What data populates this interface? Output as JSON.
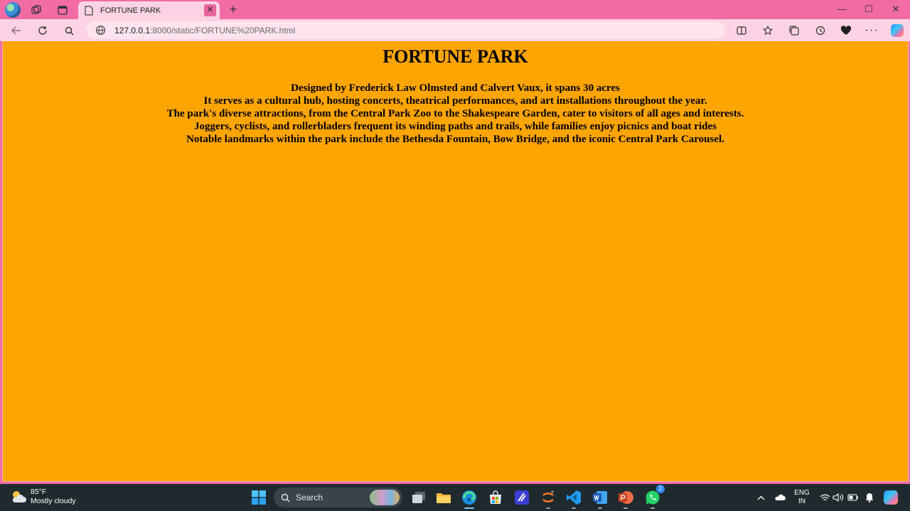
{
  "browser": {
    "tab_title": "FORTUNE PARK",
    "address_host": "127.0.0.1",
    "address_rest": ":8000/static/FORTUNE%20PARK.html",
    "window_controls": {
      "minimize": "—",
      "maximize": "☐",
      "close": "✕"
    }
  },
  "page": {
    "title": "FORTUNE PARK",
    "lines": [
      "Designed by Frederick Law Olmsted and Calvert Vaux, it spans 30 acres",
      "It serves as a cultural hub, hosting concerts, theatrical performances, and art installations throughout the year.",
      "The park's diverse attractions, from the Central Park Zoo to the Shakespeare Garden, cater to visitors of all ages and interests.",
      "Joggers, cyclists, and rollerbladers frequent its winding paths and trails, while families enjoy picnics and boat rides",
      "Notable landmarks within the park include the Bethesda Fountain, Bow Bridge, and the iconic Central Park Carousel."
    ],
    "background_color": "#ffa500"
  },
  "taskbar": {
    "weather_temp": "85°F",
    "weather_desc": "Mostly cloudy",
    "search_label": "Search",
    "whatsapp_badge": "2",
    "lang_top": "ENG",
    "lang_bottom": "IN"
  },
  "colors": {
    "titlebar": "#f26ba4",
    "toolbar": "#fbd3e4",
    "taskbar": "#1f2a2f"
  }
}
